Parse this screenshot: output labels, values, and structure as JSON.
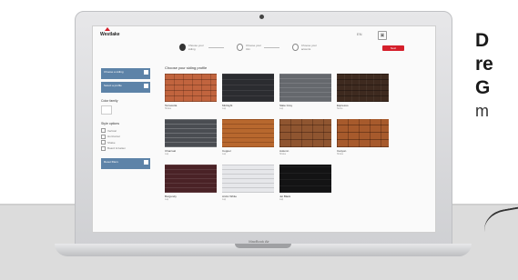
{
  "app": {
    "brand": "Westlake",
    "language": "EN",
    "header_action": "Next"
  },
  "steps": [
    {
      "label": "Choose your siding",
      "active": true
    },
    {
      "label": "Choose your trim",
      "active": false
    },
    {
      "label": "Choose your accents",
      "active": false
    }
  ],
  "sidebar": {
    "buttons": [
      {
        "label": "Choose a siding"
      },
      {
        "label": "Select a profile"
      }
    ],
    "filter_title": "Color family",
    "style_title": "Style options",
    "style_options": [
      {
        "label": "Vertical"
      },
      {
        "label": "Horizontal"
      },
      {
        "label": "Shake"
      },
      {
        "label": "Board & batten"
      }
    ],
    "bottom_button": "Reset filters"
  },
  "content": {
    "title": "Choose your siding profile"
  },
  "products": [
    {
      "name": "Terracotta",
      "sub": "Shake",
      "texture": "brick"
    },
    {
      "name": "Midnight",
      "sub": "Lap",
      "texture": "black"
    },
    {
      "name": "Slate Grey",
      "sub": "Lap",
      "texture": "grey"
    },
    {
      "name": "Espresso",
      "sub": "Stone",
      "texture": "brown"
    },
    {
      "name": "Charcoal",
      "sub": "Lap",
      "texture": "slate"
    },
    {
      "name": "Copper",
      "sub": "Lap",
      "texture": "copper"
    },
    {
      "name": "Autumn",
      "sub": "Shake",
      "texture": "shake"
    },
    {
      "name": "Canyon",
      "sub": "Shake",
      "texture": "rust"
    },
    {
      "name": "Burgundy",
      "sub": "Lap",
      "texture": "maroon"
    },
    {
      "name": "Arctic White",
      "sub": "Lap",
      "texture": "white"
    },
    {
      "name": "Jet Black",
      "sub": "Lap",
      "texture": "jet"
    }
  ],
  "laptop": {
    "model": "MacBook Air"
  },
  "marketing": {
    "line1": "D",
    "line2": "re",
    "line3": "G",
    "line4": "m"
  },
  "colors": {
    "accent": "#d51f2b",
    "sidebar_button": "#5d83a8"
  }
}
